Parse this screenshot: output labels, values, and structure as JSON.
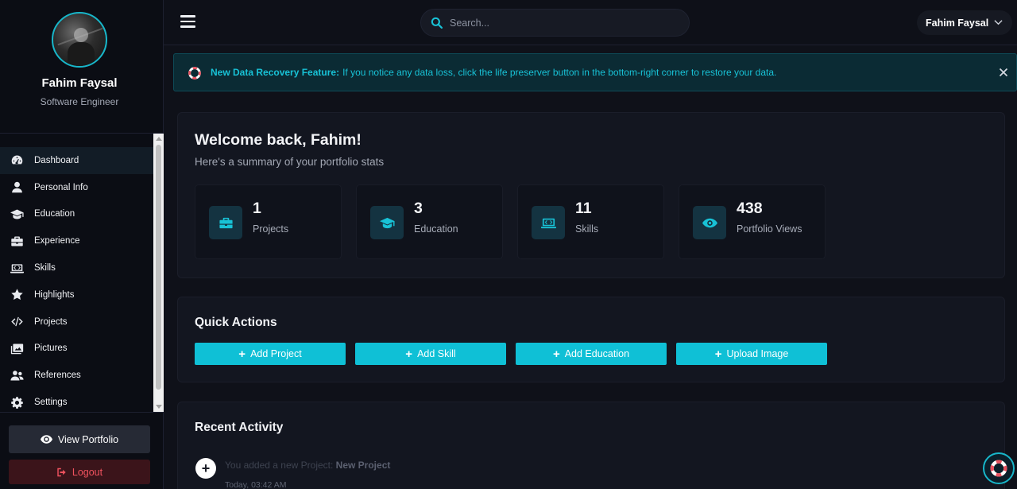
{
  "profile": {
    "name": "Fahim Faysal",
    "role": "Software Engineer"
  },
  "sidebar": {
    "items": [
      {
        "label": "Dashboard",
        "icon": "gauge-icon",
        "active": true
      },
      {
        "label": "Personal Info",
        "icon": "user-icon"
      },
      {
        "label": "Education",
        "icon": "graduation-cap-icon"
      },
      {
        "label": "Experience",
        "icon": "briefcase-icon"
      },
      {
        "label": "Skills",
        "icon": "laptop-code-icon"
      },
      {
        "label": "Highlights",
        "icon": "star-icon"
      },
      {
        "label": "Projects",
        "icon": "code-icon"
      },
      {
        "label": "Pictures",
        "icon": "images-icon"
      },
      {
        "label": "References",
        "icon": "users-icon"
      },
      {
        "label": "Settings",
        "icon": "gear-icon"
      }
    ],
    "view_portfolio": "View Portfolio",
    "logout": "Logout"
  },
  "header": {
    "search_placeholder": "Search...",
    "user_name": "Fahim Faysal"
  },
  "alert": {
    "title": "New Data Recovery Feature:",
    "message": "If you notice any data loss, click the life preserver button in the bottom-right corner to restore your data."
  },
  "welcome": {
    "title": "Welcome back, Fahim!",
    "subtitle": "Here's a summary of your portfolio stats",
    "stats": [
      {
        "value": "1",
        "label": "Projects",
        "icon": "briefcase-icon"
      },
      {
        "value": "3",
        "label": "Education",
        "icon": "graduation-cap-icon"
      },
      {
        "value": "11",
        "label": "Skills",
        "icon": "laptop-code-icon"
      },
      {
        "value": "438",
        "label": "Portfolio Views",
        "icon": "eye-icon"
      }
    ]
  },
  "quick_actions": {
    "title": "Quick Actions",
    "buttons": [
      "Add Project",
      "Add Skill",
      "Add Education",
      "Upload Image"
    ]
  },
  "recent_activity": {
    "title": "Recent Activity",
    "items": [
      {
        "prefix": "You added a new Project:",
        "target": "New Project",
        "time": "Today, 03:42 AM"
      }
    ]
  },
  "colors": {
    "accent": "#0fc0d6",
    "background": "#0f1119",
    "danger": "#f0525e"
  }
}
